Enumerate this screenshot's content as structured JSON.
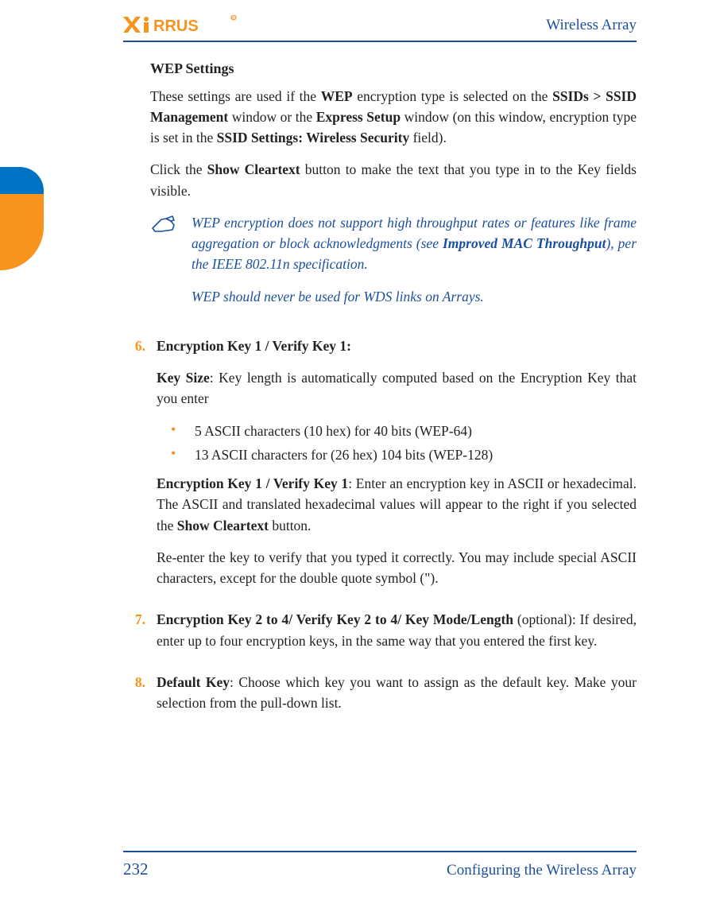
{
  "brand": "XIRRUS",
  "header_right": "Wireless Array",
  "section_title": "WEP Settings",
  "intro_parts": {
    "p1a": "These settings are used if the ",
    "p1b": "WEP",
    "p1c": " encryption type is selected on the ",
    "p1d": "SSIDs > SSID Management",
    "p1e": " window or the ",
    "p1f": "Express Setup",
    "p1g": " window (on this window, encryption type is set in the ",
    "p1h": "SSID Settings: Wireless Security",
    "p1i": " field)."
  },
  "cleartext_parts": {
    "a": "Click the ",
    "b": "Show Cleartext",
    "c": " button to make the text that you type in to the Key fields visible."
  },
  "note": {
    "p1a": "WEP encryption does not support high throughput rates or features like frame aggregation or block acknowledgments (see ",
    "p1b": "Improved MAC Throughput",
    "p1c": "), per the IEEE 802.11n specification.",
    "p2": "WEP should never be used for WDS links on Arrays."
  },
  "items": {
    "i6": {
      "num": "6.",
      "title": "Encryption Key 1 / Verify Key 1:",
      "keysize_a": "Key Size",
      "keysize_b": ": Key length is automatically computed based on the Encryption Key that you enter",
      "b1": "5 ASCII characters (10 hex) for 40 bits (WEP-64)",
      "b2": "13 ASCII characters for (26 hex) 104 bits (WEP-128)",
      "ek_a": "Encryption Key 1 / Verify Key 1",
      "ek_b": ": Enter an encryption key in ASCII or hexadecimal. The ASCII and translated hexadecimal values will appear to the right if you selected the ",
      "ek_c": "Show Cleartext",
      "ek_d": " button.",
      "reenter": "Re-enter the key to verify that you typed it correctly. You may include special ASCII characters, except for the double quote symbol (\")."
    },
    "i7": {
      "num": "7.",
      "title": "Encryption Key 2 to 4/ Verify Key 2 to 4/ Key Mode/Length",
      "rest": " (optional): If desired, enter up to four encryption keys, in the same way that you entered the first key."
    },
    "i8": {
      "num": "8.",
      "title": "Default Key",
      "rest": ": Choose which key you want to assign as the default key. Make your selection from the pull-down list."
    }
  },
  "footer": {
    "page": "232",
    "section": "Configuring the Wireless Array"
  }
}
